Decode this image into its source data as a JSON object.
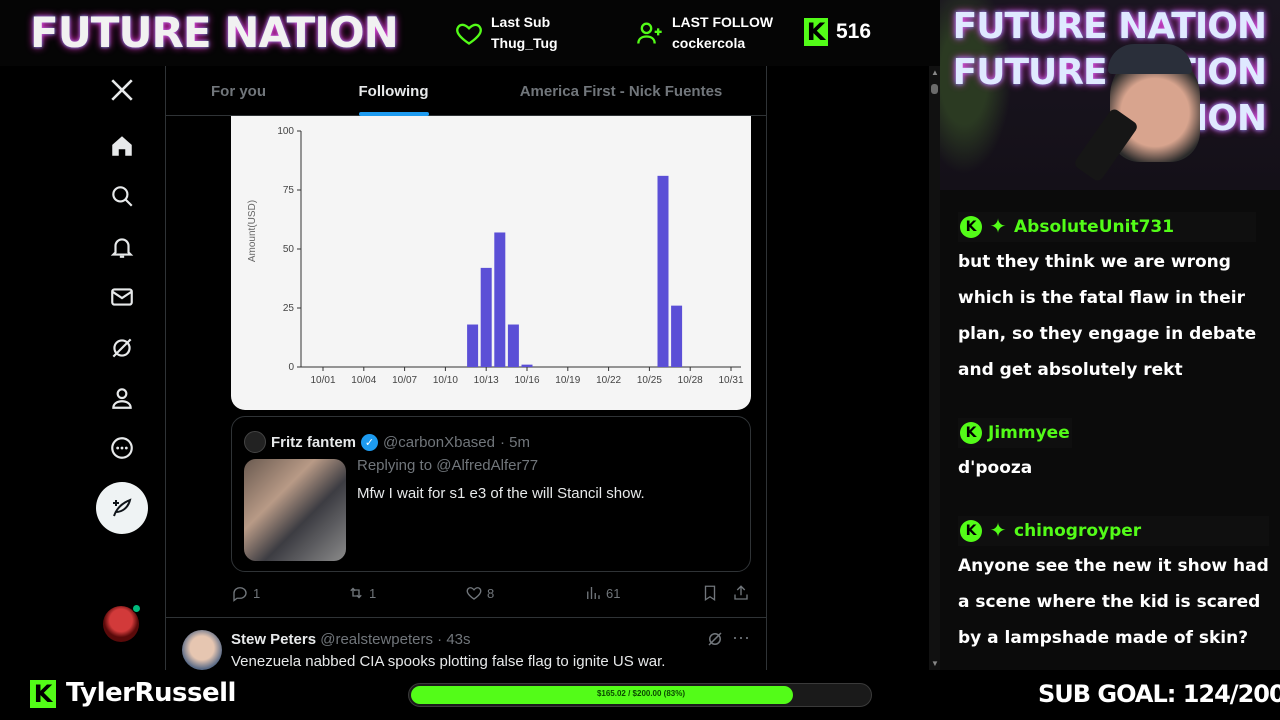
{
  "stream": {
    "brand": "FUTURE NATION",
    "last_sub": {
      "label": "Last Sub",
      "value": "Thug_Tug"
    },
    "last_follow": {
      "label": "LAST FOLLOW",
      "value": "cockercola"
    },
    "follower_count": "516",
    "streamer": "TylerRussell",
    "sub_goal_text": "SUB GOAL: 124/200",
    "progress_text": "$165.02 / $200.00 (83%)",
    "progress_fraction": 0.83,
    "brand_color": "#53fc18",
    "cam_logo_lines": [
      "FUTURE NATION",
      "FUTURE NATION",
      "NATION"
    ]
  },
  "x_nav": {
    "items": [
      {
        "name": "x-logo-icon"
      },
      {
        "name": "home-icon"
      },
      {
        "name": "search-icon"
      },
      {
        "name": "notifications-icon"
      },
      {
        "name": "messages-icon"
      },
      {
        "name": "grok-icon"
      },
      {
        "name": "profile-icon"
      },
      {
        "name": "more-icon"
      }
    ],
    "post_icon": "compose-icon"
  },
  "tabs": [
    {
      "label": "For you",
      "active": false
    },
    {
      "label": "Following",
      "active": true
    },
    {
      "label": "America First - Nick Fuentes",
      "active": false
    }
  ],
  "chart_data": {
    "type": "bar",
    "ylabel": "Amount(USD)",
    "ylim": [
      0,
      100
    ],
    "yticks": [
      0,
      25,
      50,
      75,
      100
    ],
    "xticks": [
      "10/01",
      "10/04",
      "10/07",
      "10/10",
      "10/13",
      "10/16",
      "10/19",
      "10/22",
      "10/25",
      "10/28",
      "10/31"
    ],
    "bars": [
      {
        "date": "10/12",
        "value": 18
      },
      {
        "date": "10/13",
        "value": 42
      },
      {
        "date": "10/14",
        "value": 57
      },
      {
        "date": "10/15",
        "value": 18
      },
      {
        "date": "10/16",
        "value": 1
      },
      {
        "date": "10/26",
        "value": 81
      },
      {
        "date": "10/27",
        "value": 26
      }
    ],
    "bar_color": "#5b4fd6"
  },
  "quote_tweet": {
    "name": "Fritz fantem",
    "handle": "@carbonXbased",
    "time": "· 5m",
    "replying": "Replying to @AlfredAlfer77",
    "text": "Mfw I wait for s1 e3 of the will Stancil show."
  },
  "actions": {
    "replies": "1",
    "reposts": "1",
    "likes": "8",
    "views": "61"
  },
  "tweet2": {
    "name": "Stew Peters",
    "handle": "@realstewpeters",
    "time": "· 43s",
    "text": "Venezuela nabbed CIA spooks plotting false flag to ignite US war."
  },
  "chat": [
    {
      "user": "AbsoluteUnit731",
      "badge": true,
      "lines": [
        "but they think we are wrong",
        "which is the fatal flaw in their",
        "plan, so they engage in debate",
        "and get absolutely rekt"
      ]
    },
    {
      "user": "Jimmyee",
      "badge": false,
      "lines": [
        "d'pooza"
      ]
    },
    {
      "user": "chinogroyper",
      "badge": true,
      "lines": [
        "Anyone see the new it show had",
        "a scene where the kid is scared",
        "by a lampshade made of skin?"
      ]
    }
  ]
}
